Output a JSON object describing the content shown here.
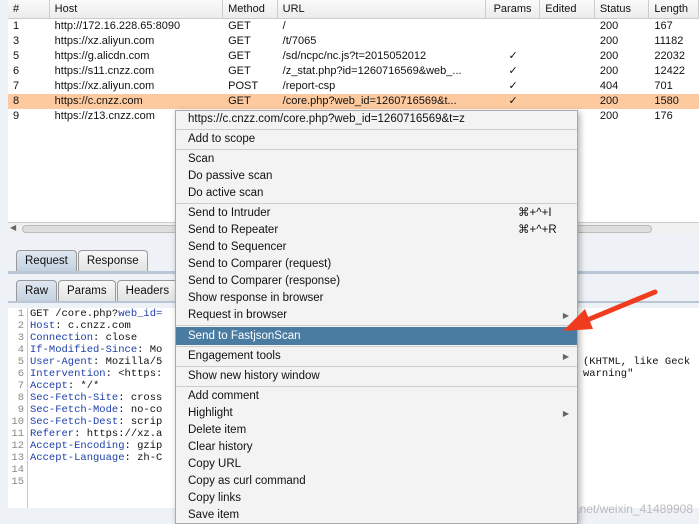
{
  "table": {
    "columns": [
      "#",
      "Host",
      "Method",
      "URL",
      "Params",
      "Edited",
      "Status",
      "Length"
    ],
    "rows": [
      [
        "1",
        "http://172.16.228.65:8090",
        "GET",
        "/",
        "",
        "",
        "200",
        "167"
      ],
      [
        "3",
        "https://xz.aliyun.com",
        "GET",
        "/t/7065",
        "",
        "",
        "200",
        "11182"
      ],
      [
        "5",
        "https://g.alicdn.com",
        "GET",
        "/sd/ncpc/nc.js?t=2015052012",
        "✓",
        "",
        "200",
        "22032"
      ],
      [
        "6",
        "https://s11.cnzz.com",
        "GET",
        "/z_stat.php?id=1260716569&web_...",
        "✓",
        "",
        "200",
        "12422"
      ],
      [
        "7",
        "https://xz.aliyun.com",
        "POST",
        "/report-csp",
        "✓",
        "",
        "404",
        "701"
      ],
      [
        "8",
        "https://c.cnzz.com",
        "GET",
        "/core.php?web_id=1260716569&t...",
        "✓",
        "",
        "200",
        "1580"
      ],
      [
        "9",
        "https://z13.cnzz.com",
        "",
        "",
        "",
        "",
        "200",
        "176"
      ]
    ],
    "selected_row": 5,
    "highlight_color": "#fdc99f"
  },
  "tabs1": [
    "Request",
    "Response"
  ],
  "tabs2": [
    "Raw",
    "Params",
    "Headers"
  ],
  "editor": {
    "gutter": [
      "1",
      "2",
      "3",
      "4",
      "5",
      "6",
      "7",
      "8",
      "9",
      "10",
      "11",
      "12",
      "13",
      "14",
      "15"
    ],
    "lines": [
      [
        "GET /core.php?",
        "web_id="
      ],
      [
        "Host",
        ": c.cnzz.com"
      ],
      [
        "Connection",
        ": close"
      ],
      [
        "If-Modified-Since",
        ": Mo"
      ],
      [
        "User-Agent",
        ": Mozilla/5"
      ],
      [
        "Intervention",
        ": <https:"
      ],
      [
        "Accept",
        ": */*"
      ],
      [
        "Sec-Fetch-Site",
        ": cross"
      ],
      [
        "Sec-Fetch-Mode",
        ": no-co"
      ],
      [
        "Sec-Fetch-Dest",
        ": scrip"
      ],
      [
        "Referer",
        ": https://xz.a"
      ],
      [
        "Accept-Encoding",
        ": gzip"
      ],
      [
        "Accept-Language",
        ": zh-C"
      ],
      [
        "",
        ""
      ],
      [
        "",
        ""
      ]
    ],
    "right_fragments": [
      "(KHTML, like Geck",
      "warning\""
    ]
  },
  "menu": {
    "items": [
      {
        "label": "https://c.cnzz.com/core.php?web_id=1260716569&t=z"
      },
      {
        "label": "Add to scope",
        "sep": true
      },
      {
        "label": "Scan"
      },
      {
        "label": "Do passive scan"
      },
      {
        "label": "Do active scan",
        "sep": true
      },
      {
        "label": "Send to Intruder",
        "shortcut": "⌘+^+I"
      },
      {
        "label": "Send to Repeater",
        "shortcut": "⌘+^+R"
      },
      {
        "label": "Send to Sequencer"
      },
      {
        "label": "Send to Comparer (request)"
      },
      {
        "label": "Send to Comparer (response)"
      },
      {
        "label": "Show response in browser"
      },
      {
        "label": "Request in browser",
        "submenu": true,
        "sep": true
      },
      {
        "label": "Send to FastjsonScan",
        "highlighted": true,
        "sep": true
      },
      {
        "label": "Engagement tools",
        "submenu": true,
        "sep": true
      },
      {
        "label": "Show new history window",
        "sep": true
      },
      {
        "label": "Add comment"
      },
      {
        "label": "Highlight",
        "submenu": true
      },
      {
        "label": "Delete item"
      },
      {
        "label": "Clear history"
      },
      {
        "label": "Copy URL"
      },
      {
        "label": "Copy as curl command"
      },
      {
        "label": "Copy links"
      },
      {
        "label": "Save item"
      }
    ]
  },
  "watermark": "https://blog.csdn.net/weixin_41489908",
  "arrow_color": "#f03c1e"
}
